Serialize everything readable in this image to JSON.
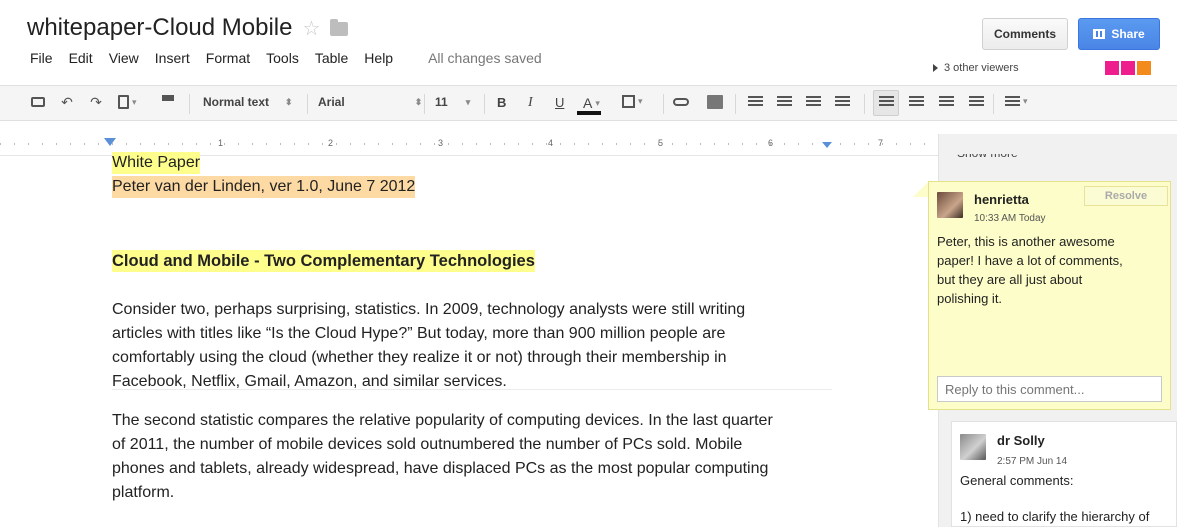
{
  "header": {
    "title": "whitepaper-Cloud Mobile",
    "email_fragment": "...@...",
    "saved_status": "All changes saved",
    "comments_button": "Comments",
    "share_button": "Share",
    "viewers_text": "3 other viewers",
    "viewer_colors": [
      "#ee1f8c",
      "#ee1f8c",
      "#f28a1c"
    ]
  },
  "menu": [
    "File",
    "Edit",
    "View",
    "Insert",
    "Format",
    "Tools",
    "Table",
    "Help"
  ],
  "toolbar": {
    "style": "Normal text",
    "font": "Arial",
    "size": "11",
    "bold": "B",
    "italic": "I",
    "underline": "U",
    "text_color": "A"
  },
  "ruler": [
    "1",
    "2",
    "3",
    "4",
    "5",
    "6",
    "7"
  ],
  "document": {
    "line1": "White Paper",
    "line2": "Peter van der Linden, ver 1.0, June 7 2012",
    "heading": "Cloud and Mobile - Two Complementary Technologies",
    "para1": [
      "Consider two, perhaps surprising, statistics. In 2009, technology analysts were still writing",
      "articles with titles like “Is the Cloud Hype?” But today, more than 900 million people are",
      "comfortably using the cloud (whether they realize it or not) through their membership in",
      "Facebook, Netflix, Gmail, Amazon, and similar services."
    ],
    "para2": [
      "The second statistic compares the relative popularity of computing devices. In the last quarter",
      "of 2011, the number of mobile devices sold outnumbered the number of PCs sold. Mobile",
      "phones and tablets, already widespread, have displaced PCs as the most popular computing",
      "platform."
    ]
  },
  "comments": {
    "show_more": "Show more",
    "active": {
      "author": "henrietta",
      "time": "10:33 AM Today",
      "resolve": "Resolve",
      "text": [
        "Peter, this is another awesome",
        "paper! I have a lot of comments,",
        "but they are all just about",
        "polishing it."
      ],
      "reply_placeholder": "Reply to this comment..."
    },
    "second": {
      "author": "dr Solly",
      "time": "2:57 PM Jun 14",
      "text": "General comments:",
      "text2": "1) need to clarify the hierarchy of"
    }
  }
}
